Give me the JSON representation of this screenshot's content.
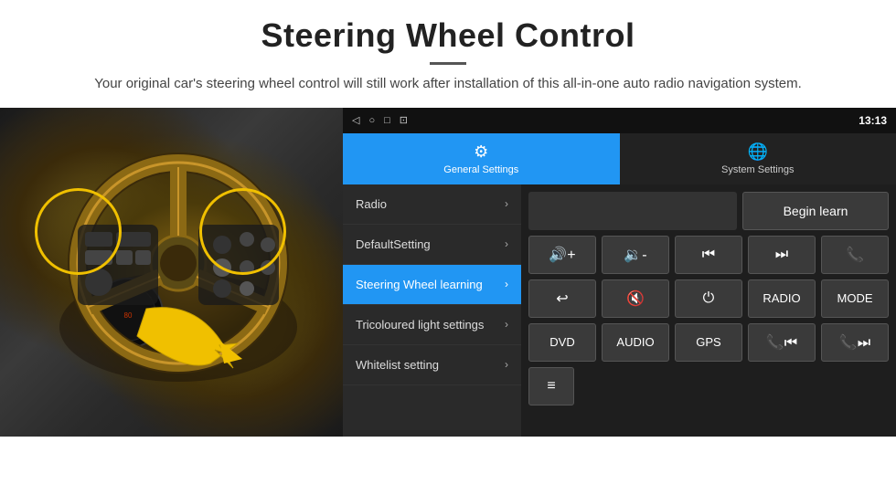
{
  "header": {
    "title": "Steering Wheel Control",
    "divider": true,
    "subtitle": "Your original car's steering wheel control will still work after installation of this all-in-one auto radio navigation system."
  },
  "status_bar": {
    "nav_back": "◁",
    "nav_home": "○",
    "nav_recent": "□",
    "nav_cast": "⊡",
    "wifi_icon": "wifi",
    "signal_icon": "signal",
    "time": "13:13"
  },
  "tabs": [
    {
      "id": "general",
      "label": "General Settings",
      "icon": "⚙",
      "active": true
    },
    {
      "id": "system",
      "label": "System Settings",
      "icon": "🌐",
      "active": false
    }
  ],
  "menu_items": [
    {
      "id": "radio",
      "label": "Radio",
      "active": false
    },
    {
      "id": "default",
      "label": "DefaultSetting",
      "active": false
    },
    {
      "id": "steering",
      "label": "Steering Wheel learning",
      "active": true
    },
    {
      "id": "tricoloured",
      "label": "Tricoloured light settings",
      "active": false
    },
    {
      "id": "whitelist",
      "label": "Whitelist setting",
      "active": false
    }
  ],
  "controls": {
    "begin_learn_label": "Begin learn",
    "buttons_row1": [
      {
        "id": "vol-up",
        "label": "🔊+"
      },
      {
        "id": "vol-down",
        "label": "🔉-"
      },
      {
        "id": "prev",
        "label": "⏮"
      },
      {
        "id": "next",
        "label": "⏭"
      },
      {
        "id": "phone",
        "label": "📞"
      }
    ],
    "buttons_row2": [
      {
        "id": "hook",
        "label": "↩"
      },
      {
        "id": "mute",
        "label": "🔇"
      },
      {
        "id": "power",
        "label": "⏻"
      },
      {
        "id": "radio-btn",
        "label": "RADIO"
      },
      {
        "id": "mode-btn",
        "label": "MODE"
      }
    ],
    "buttons_row3": [
      {
        "id": "dvd",
        "label": "DVD"
      },
      {
        "id": "audio",
        "label": "AUDIO"
      },
      {
        "id": "gps",
        "label": "GPS"
      },
      {
        "id": "prev-call",
        "label": "📞⏮"
      },
      {
        "id": "next-call",
        "label": "📞⏭"
      }
    ],
    "bottom_icon": "≡"
  }
}
